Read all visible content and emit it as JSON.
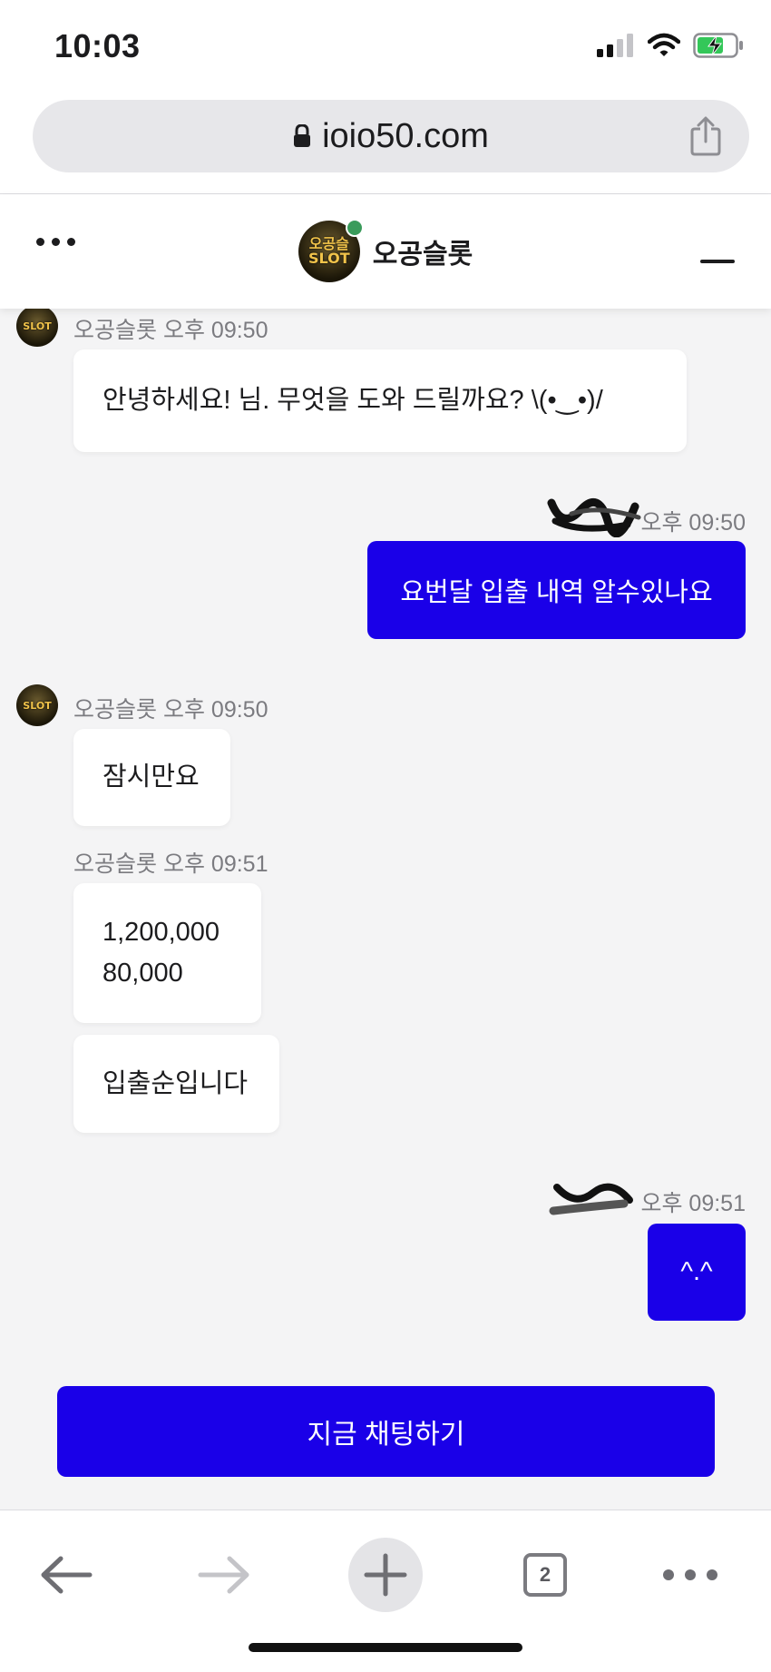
{
  "status_bar": {
    "time": "10:03"
  },
  "browser": {
    "url": "ioio50.com",
    "tab_count": "2"
  },
  "chat_header": {
    "title": "오공슬롯",
    "logo_text": "오공슬\nSLOT"
  },
  "messages": [
    {
      "sender": "오공슬롯",
      "time": "오후 09:50",
      "text": "안녕하세요! 님. 무엇을 도와 드릴까요? \\(•‿•)/"
    },
    {
      "sender": "",
      "time": "오후 09:50",
      "text": "요번달 입출 내역 알수있나요"
    },
    {
      "sender": "오공슬롯",
      "time": "오후 09:50",
      "text": "잠시만요"
    },
    {
      "sender": "오공슬롯",
      "time": "오후 09:51",
      "lines": [
        "1,200,000",
        "80,000"
      ]
    },
    {
      "text": "입출순입니다"
    },
    {
      "sender": "",
      "time": "오후 09:51",
      "text": "^.^"
    }
  ],
  "cta": {
    "label": "지금 채팅하기"
  },
  "colors": {
    "accent": "#1a00e8",
    "background": "#f4f4f5",
    "online": "#3a9b5b"
  },
  "icons": [
    "lock-icon",
    "share-icon",
    "more-dots-icon",
    "minimize-icon",
    "back-arrow-icon",
    "forward-arrow-icon",
    "plus-icon",
    "tabs-icon",
    "more-options-icon",
    "signal-icon",
    "wifi-icon",
    "battery-icon"
  ]
}
